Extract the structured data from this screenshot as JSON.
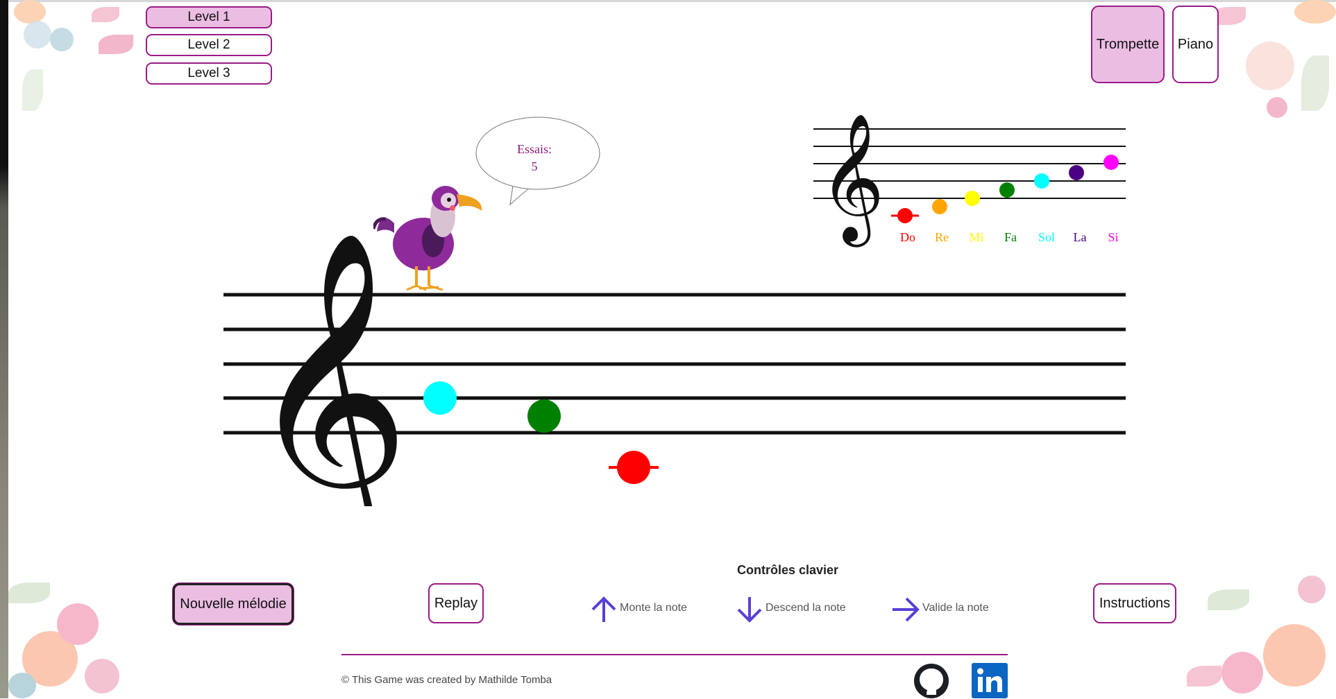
{
  "levels": [
    {
      "label": "Level 1",
      "active": true
    },
    {
      "label": "Level 2",
      "active": false
    },
    {
      "label": "Level 3",
      "active": false
    }
  ],
  "instruments": [
    {
      "label": "Trompette",
      "active": true
    },
    {
      "label": "Piano",
      "active": false
    }
  ],
  "speech_bubble": {
    "line1": "Essais:",
    "line2": "5"
  },
  "staff_notes": [
    {
      "note": "Sol",
      "color": "#00ffff"
    },
    {
      "note": "Fa",
      "color": "#008000"
    },
    {
      "note": "Do",
      "color": "#ff0000"
    }
  ],
  "note_legend": [
    {
      "name": "Do",
      "color": "#ff0000"
    },
    {
      "name": "Re",
      "color": "#ffa500"
    },
    {
      "name": "Mi",
      "color": "#ffff00"
    },
    {
      "name": "Fa",
      "color": "#008000"
    },
    {
      "name": "Sol",
      "color": "#00ffff"
    },
    {
      "name": "La",
      "color": "#4b0082"
    },
    {
      "name": "Si",
      "color": "#ff00ff"
    }
  ],
  "controls": {
    "title": "Contrôles clavier",
    "items": [
      {
        "label": "Monte la note",
        "icon": "arrow-up-icon"
      },
      {
        "label": "Descend la note",
        "icon": "arrow-down-icon"
      },
      {
        "label": "Valide la note",
        "icon": "arrow-right-icon"
      }
    ]
  },
  "buttons": {
    "new_melody": "Nouvelle mélodie",
    "replay": "Replay",
    "instructions": "Instructions"
  },
  "footer": {
    "credit": "© This Game was created by Mathilde Tomba"
  },
  "colors": {
    "accent": "#9a1a86",
    "active_fill": "#ecbde3",
    "arrow": "#5b3fd6",
    "linkedin": "#0a66c2"
  }
}
